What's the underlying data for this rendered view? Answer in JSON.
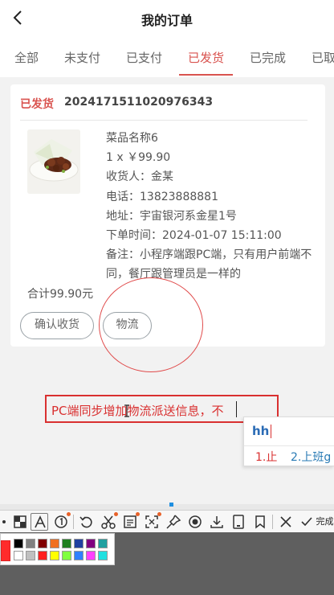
{
  "header": {
    "title": "我的订单",
    "back_icon": "chevron-left-icon"
  },
  "tabs": [
    {
      "label": "全部",
      "active": false
    },
    {
      "label": "未支付",
      "active": false
    },
    {
      "label": "已支付",
      "active": false
    },
    {
      "label": "已发货",
      "active": true
    },
    {
      "label": "已完成",
      "active": false
    },
    {
      "label": "已取",
      "active": false
    }
  ],
  "order": {
    "status": "已发货",
    "order_no": "2024171511020976343",
    "item_name": "菜品名称6",
    "qty_price": "1 x ￥99.90",
    "receiver": "收货人：金某",
    "phone": "电话：13823888881",
    "address": "地址：宇宙银河系金星1号",
    "order_time": "下单时间：2024-01-07 15:11:00",
    "remark": "备注：小程序端跟PC端，只有用户前端不同，餐厅跟管理员是一样的",
    "total": "合计99.90元",
    "confirm_button": "确认收货",
    "logistics_button": "物流"
  },
  "annotation": {
    "text": "PC端同步增加物流派送信息，不",
    "color": "#d93030"
  },
  "ime": {
    "input": "hh",
    "candidate_1": "1.止",
    "candidate_2": "2.上班g"
  },
  "toolbar": {
    "finish_label": "完成",
    "icons": [
      "mosaic-icon",
      "text-icon",
      "number-marker-icon",
      "undo-icon",
      "scissors-icon",
      "ocr-icon",
      "crop-icon",
      "pin-icon",
      "record-icon",
      "download-icon",
      "copy-icon",
      "save-icon",
      "close-icon",
      "check-icon"
    ]
  },
  "palette": {
    "current": "#ff2b2b",
    "colors": [
      "#000000",
      "#808080",
      "#800000",
      "#f07020",
      "#208020",
      "#2040a0",
      "#800080",
      "#20a0a0",
      "#ffffff",
      "#c0c0c0",
      "#ff2020",
      "#ffff00",
      "#80ff40",
      "#3080ff",
      "#ff40ff",
      "#20e0e0"
    ]
  }
}
